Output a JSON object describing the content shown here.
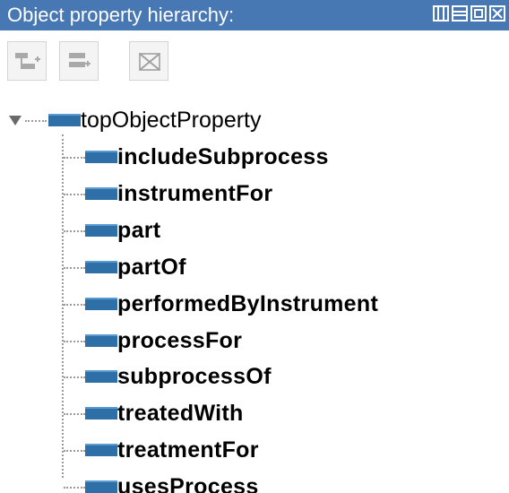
{
  "panel": {
    "title": "Object property hierarchy:",
    "title_bar_color": "#4878b4",
    "window_buttons": [
      "maximize-icon",
      "minimize-icon",
      "restore-icon",
      "close-icon"
    ]
  },
  "toolbar": {
    "buttons": [
      {
        "icon": "add-subproperty-icon",
        "enabled": false
      },
      {
        "icon": "add-sibling-property-icon",
        "enabled": false
      },
      {
        "icon": "delete-property-icon",
        "enabled": false
      }
    ]
  },
  "tree": {
    "root": {
      "label": "topObjectProperty",
      "expanded": true,
      "icon": "object-property-icon",
      "icon_color": "#2f6fa8"
    },
    "children": [
      {
        "label": "includeSubprocess"
      },
      {
        "label": "instrumentFor"
      },
      {
        "label": "part"
      },
      {
        "label": "partOf"
      },
      {
        "label": "performedByInstrument"
      },
      {
        "label": "processFor"
      },
      {
        "label": "subprocessOf"
      },
      {
        "label": "treatedWith"
      },
      {
        "label": "treatmentFor"
      },
      {
        "label": "usesProcess"
      }
    ]
  }
}
